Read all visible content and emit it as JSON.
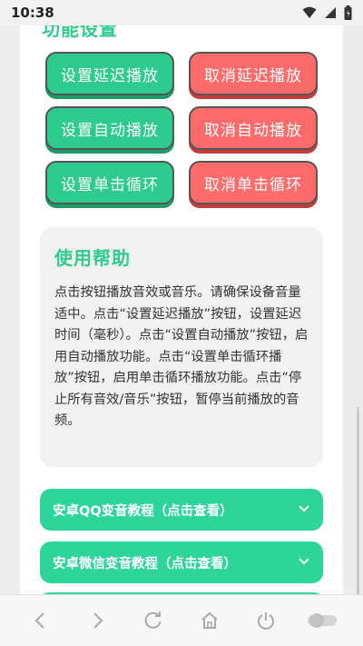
{
  "status_bar": {
    "time": "10:38"
  },
  "section": {
    "title": "功能设置"
  },
  "buttons": {
    "set_delay": "设置延迟播放",
    "cancel_delay": "取消延迟播放",
    "set_auto": "设置自动播放",
    "cancel_auto": "取消自动播放",
    "set_loop": "设置单击循环",
    "cancel_loop": "取消单击循环"
  },
  "help": {
    "title": "使用帮助",
    "text": "点击按钮播放音效或音乐。请确保设备音量适中。点击“设置延迟播放”按钮，设置延迟时间（毫秒）。点击“设置自动播放”按钮，启用自动播放功能。点击“设置单击循环播放”按钮，启用单击循环播放功能。点击“停止所有音效/音乐”按钮，暂停当前播放的音频。"
  },
  "accordions": [
    {
      "label": "安卓QQ变音教程（点击查看）"
    },
    {
      "label": "安卓微信变音教程（点击查看）"
    }
  ],
  "colors": {
    "accent_green": "#2dcb8e",
    "accent_red": "#ff6b6b"
  },
  "icons": {
    "status": [
      "wifi-icon",
      "signal-icon",
      "battery-icon"
    ],
    "nav": [
      "back-icon",
      "forward-icon",
      "refresh-icon",
      "home-icon",
      "power-icon",
      "toggle-icon"
    ]
  }
}
